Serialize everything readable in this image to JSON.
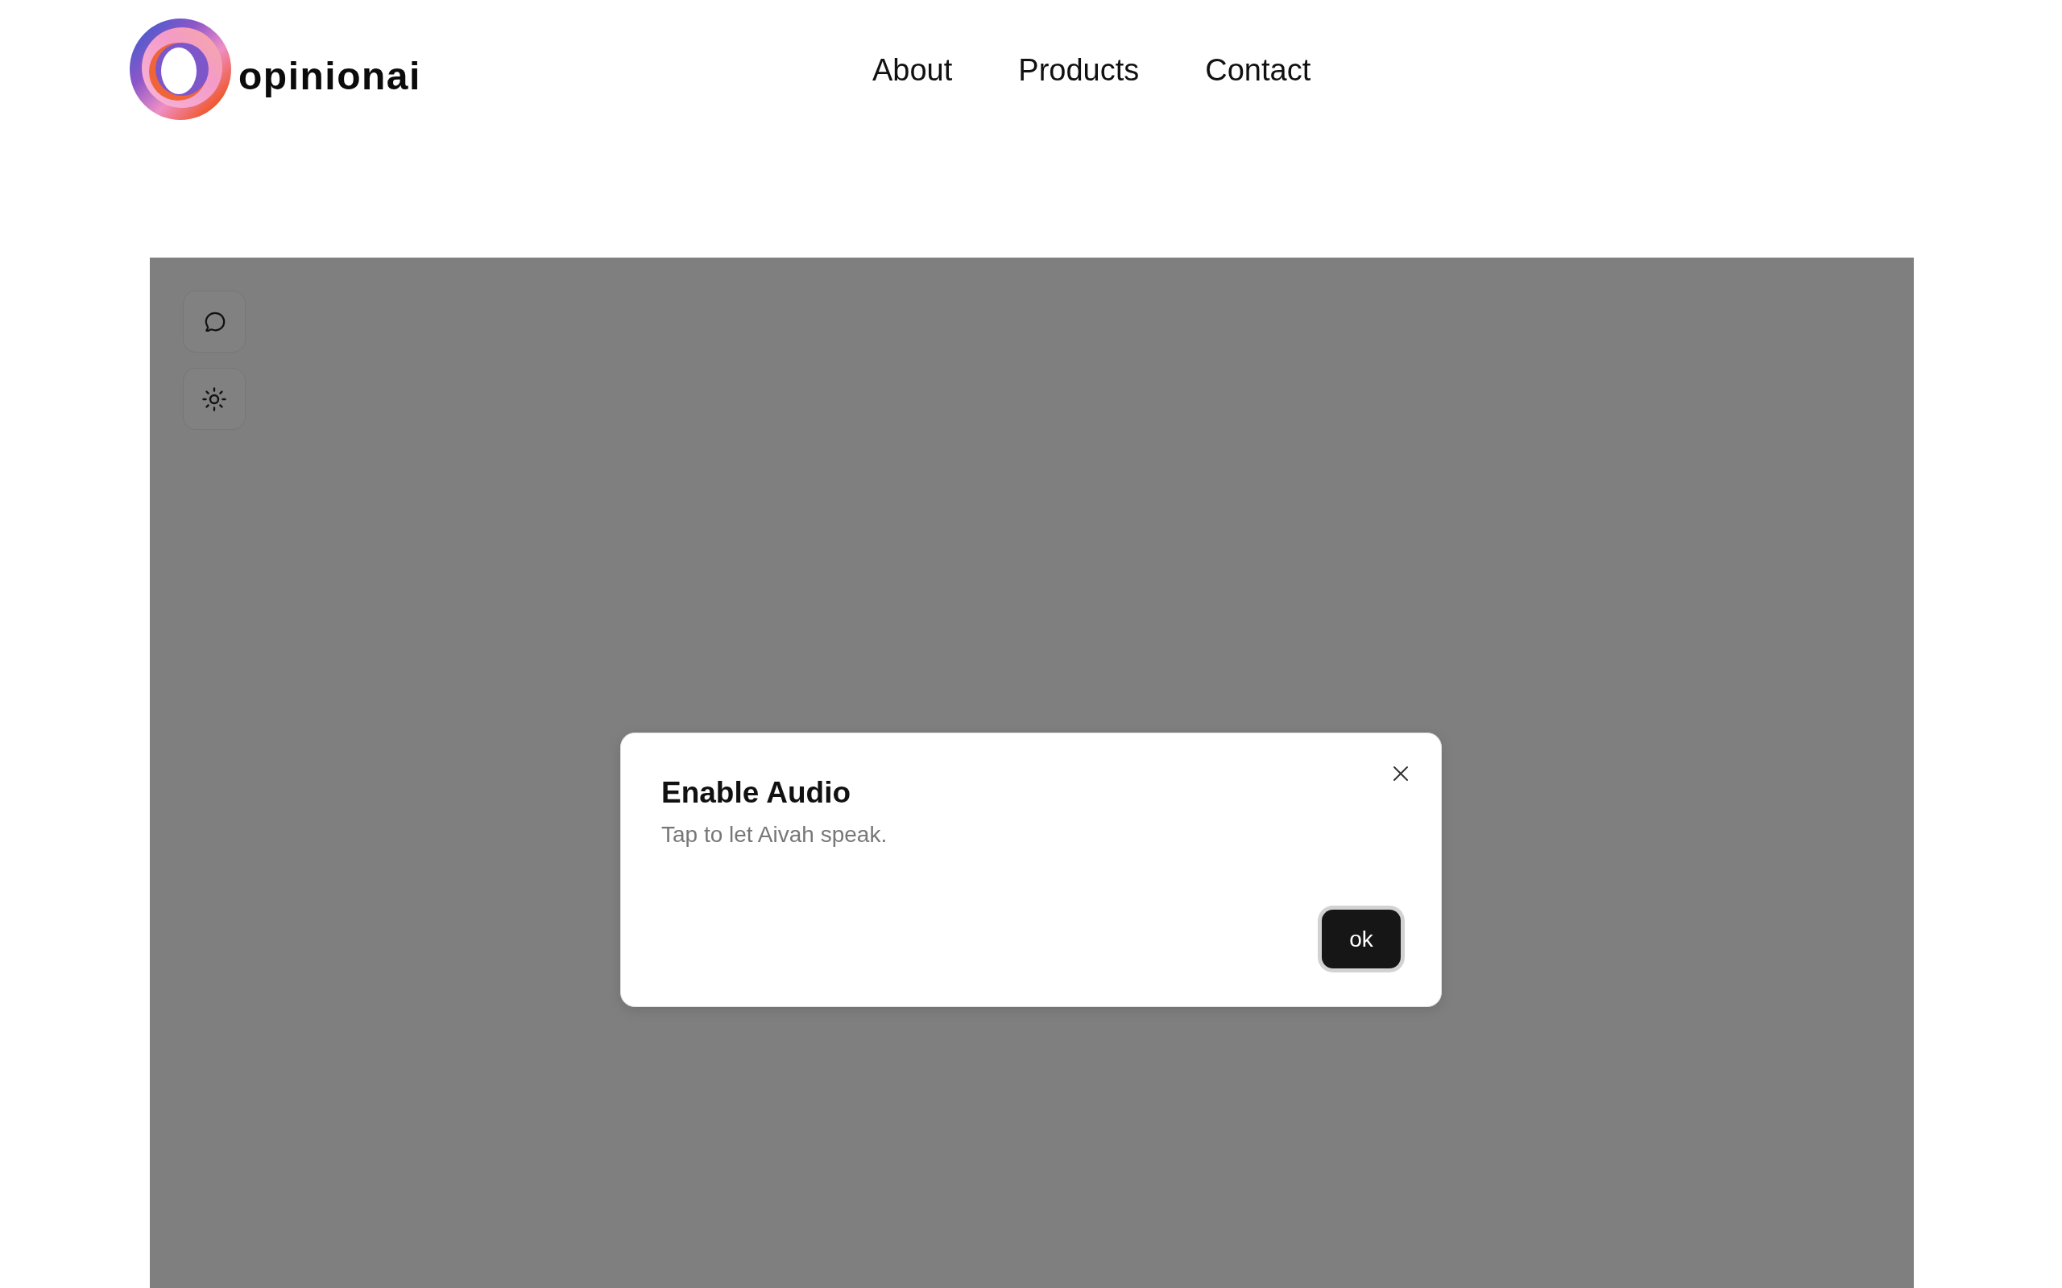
{
  "header": {
    "brand": "opinionai",
    "nav": [
      {
        "label": "About"
      },
      {
        "label": "Products"
      },
      {
        "label": "Contact"
      }
    ]
  },
  "sidebar": {
    "buttons": [
      {
        "kind": "chat"
      },
      {
        "kind": "theme"
      }
    ]
  },
  "dialog": {
    "title": "Enable Audio",
    "message": "Tap to let Aivah speak.",
    "ok_button": {
      "label": "ok",
      "focused": true
    }
  }
}
